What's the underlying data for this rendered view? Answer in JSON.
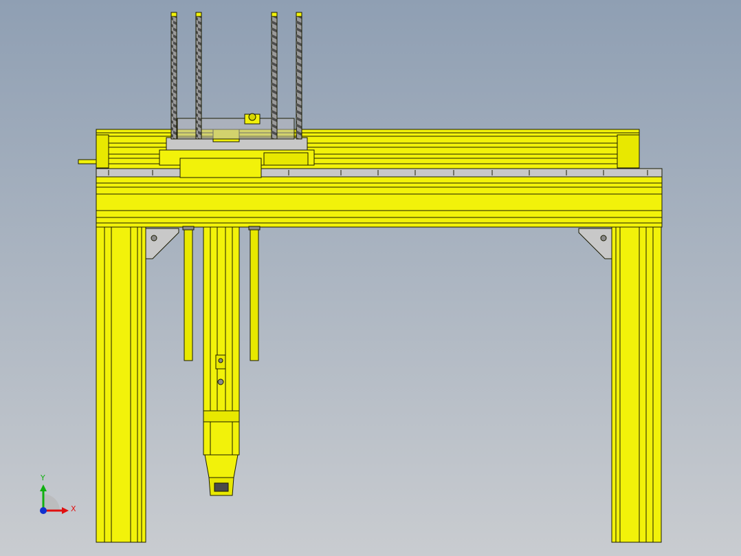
{
  "viewport": {
    "background_top": "#8f9fb3",
    "background_bottom": "#c9ccd0"
  },
  "colors": {
    "frame": "#f2f20a",
    "frame_shade": "#d6d600",
    "edge": "#1a1a00",
    "steel": "#8a8a8a",
    "steel_dark": "#4a4a4a",
    "plate": "#c8c8c8"
  },
  "triad": {
    "x_label": "X",
    "y_label": "Y",
    "x_color": "#e01010",
    "y_color": "#10b010",
    "z_color": "#1030d0"
  }
}
